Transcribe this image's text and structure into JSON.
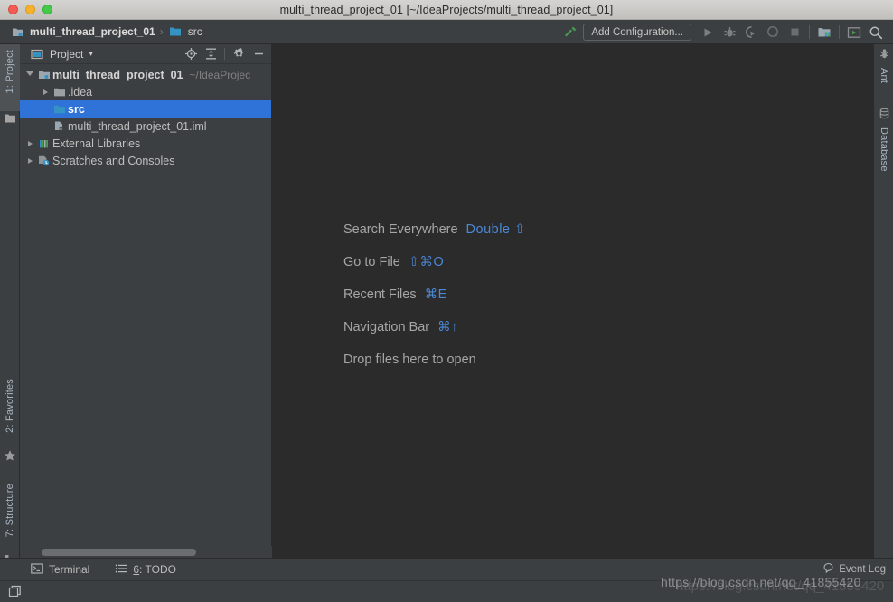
{
  "window": {
    "title": "multi_thread_project_01 [~/IdeaProjects/multi_thread_project_01]",
    "traffic_lights": [
      "close",
      "minimize",
      "zoom"
    ]
  },
  "navbar": {
    "crumbs": [
      {
        "label": "multi_thread_project_01",
        "icon": "module-icon",
        "bold": true
      },
      {
        "label": "src",
        "icon": "folder-icon",
        "bold": false
      }
    ],
    "separator": "›"
  },
  "toolbar": {
    "build_label": "build-hammer-icon",
    "run_configuration": "Add Configuration...",
    "buttons": [
      {
        "name": "run-button",
        "label": "Run"
      },
      {
        "name": "debug-button",
        "label": "Debug"
      },
      {
        "name": "run-with-coverage-button",
        "label": "Run with Coverage"
      },
      {
        "name": "profile-button",
        "label": "Profile"
      },
      {
        "name": "stop-button",
        "label": "Stop"
      },
      {
        "name": "project-structure-button",
        "label": "Project Structure"
      },
      {
        "name": "updates-button",
        "label": "Updates"
      },
      {
        "name": "search-button",
        "label": "Search Everywhere"
      }
    ]
  },
  "left_strip": {
    "tabs": [
      {
        "label": "1: Project",
        "icon": "project-icon",
        "active": true
      },
      {
        "label": "2: Favorites",
        "icon": "star-icon",
        "active": false
      },
      {
        "label": "7: Structure",
        "icon": "structure-icon",
        "active": false
      }
    ]
  },
  "right_strip": {
    "tabs": [
      {
        "label": "Ant",
        "icon": "ant-icon"
      },
      {
        "label": "Database",
        "icon": "database-icon"
      }
    ]
  },
  "project_panel": {
    "title": "Project",
    "dropdown_caret": "▾",
    "header_icons": [
      {
        "name": "locate-icon",
        "label": "Select Opened File"
      },
      {
        "name": "collapse-all-icon",
        "label": "Collapse All"
      },
      {
        "name": "gear-icon",
        "label": "Settings"
      },
      {
        "name": "hide-icon",
        "label": "Hide"
      }
    ],
    "tree": [
      {
        "label": "multi_thread_project_01",
        "path": "~/IdeaProjec",
        "icon": "module-icon",
        "twisty": "open",
        "indent": 0,
        "bold": true,
        "selected": false
      },
      {
        "label": ".idea",
        "path": "",
        "icon": "folder-grey-icon",
        "twisty": "closed",
        "indent": 1,
        "bold": false,
        "selected": false
      },
      {
        "label": "src",
        "path": "",
        "icon": "folder-source-icon",
        "twisty": "none",
        "indent": 1,
        "bold": true,
        "selected": true
      },
      {
        "label": "multi_thread_project_01.iml",
        "path": "",
        "icon": "iml-file-icon",
        "twisty": "none",
        "indent": 1,
        "bold": false,
        "selected": false
      },
      {
        "label": "External Libraries",
        "path": "",
        "icon": "libraries-icon",
        "twisty": "closed",
        "indent": 0,
        "bold": false,
        "selected": false
      },
      {
        "label": "Scratches and Consoles",
        "path": "",
        "icon": "scratches-icon",
        "twisty": "closed",
        "indent": 0,
        "bold": false,
        "selected": false
      }
    ]
  },
  "editor": {
    "tips": [
      {
        "label": "Search Everywhere",
        "key": "Double ⇧"
      },
      {
        "label": "Go to File",
        "key": "⇧⌘O"
      },
      {
        "label": "Recent Files",
        "key": "⌘E"
      },
      {
        "label": "Navigation Bar",
        "key": "⌘↑"
      },
      {
        "label": "Drop files here to open",
        "key": ""
      }
    ]
  },
  "bottom_bar": {
    "items": [
      {
        "label": "Terminal",
        "icon": "terminal-icon",
        "mnemonic": ""
      },
      {
        "label": ": TODO",
        "icon": "todo-icon",
        "mnemonic": "6"
      }
    ],
    "event_log": "Event Log"
  },
  "status_bar": {
    "icon": "layout-icon"
  },
  "watermark": "https://blog.csdn.net/qq_41855420",
  "colors": {
    "editor_bg": "#2b2b2b",
    "panel_bg": "#3c3f41",
    "selection_blue": "#2f72d8",
    "key_blue": "#4a88d6",
    "accent_green": "#499c54",
    "text": "#bbbbbb"
  }
}
